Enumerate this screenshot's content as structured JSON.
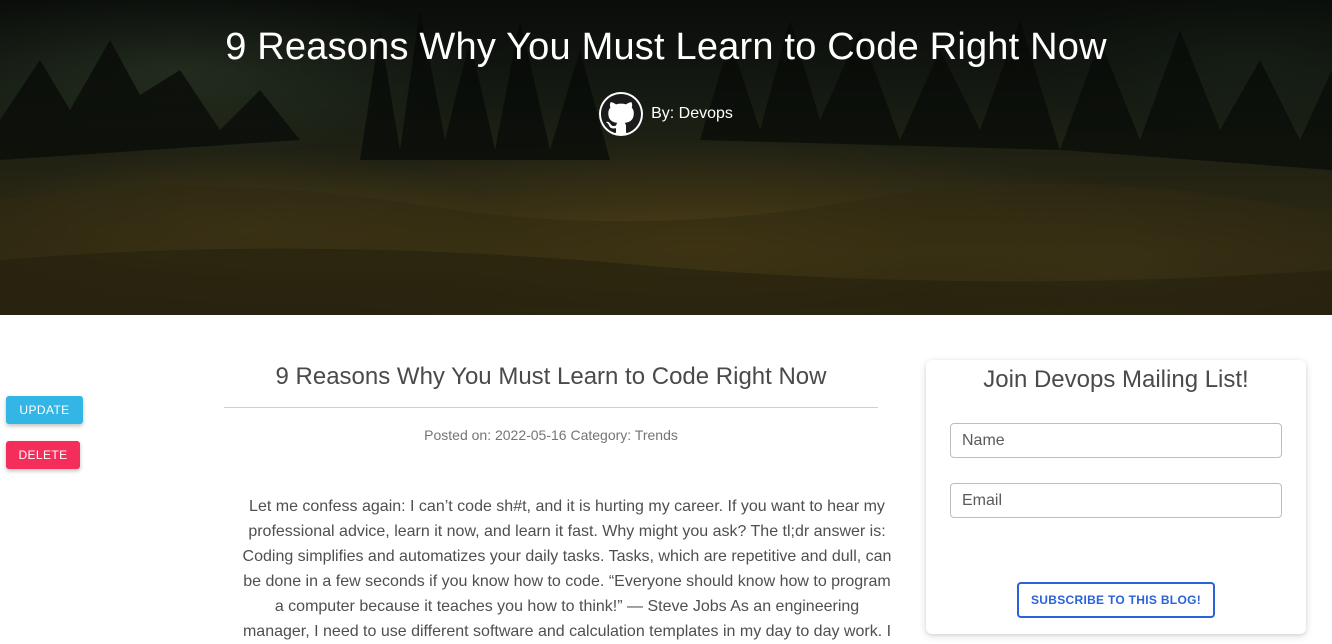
{
  "hero": {
    "title": "9 Reasons Why You Must Learn to Code Right Now",
    "author_label": "By: Devops",
    "avatar_icon": "github-icon"
  },
  "actions": {
    "update_label": "UPDATE",
    "delete_label": "DELETE",
    "update_color": "#33b5e5",
    "delete_color": "#f52d5a"
  },
  "article": {
    "title": "9 Reasons Why You Must Learn to Code Right Now",
    "meta": "Posted on: 2022-05-16 Category: Trends",
    "body": "Let me confess again: I can’t code sh#t, and it is hurting my career. If you want to hear my professional advice, learn it now, and learn it fast. Why might you ask? The tl;dr answer is: Coding simplifies and automatizes your daily tasks. Tasks, which are repetitive and dull, can be done in a few seconds if you know how to code. “Everyone should know how to program a computer because it teaches you how to think!” — Steve Jobs As an engineering manager, I need to use different software and calculation templates in my day to day work. I also need"
  },
  "mailing": {
    "title": "Join Devops Mailing List!",
    "name_placeholder": "Name",
    "email_placeholder": "Email",
    "subscribe_label": "SUBSCRIBE TO THIS BLOG!",
    "accent_color": "#2962d9"
  }
}
